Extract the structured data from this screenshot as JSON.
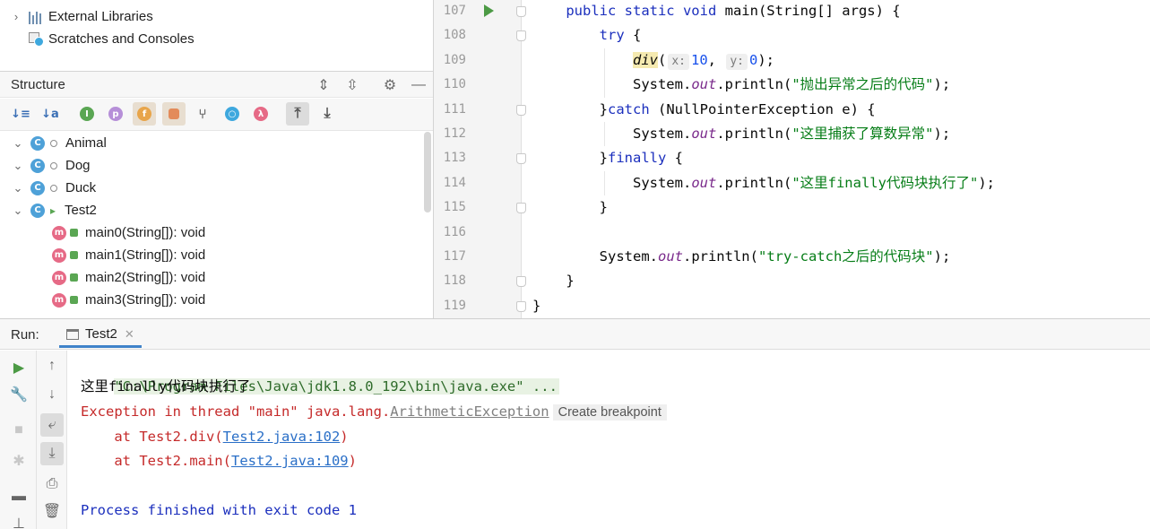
{
  "project_tree": {
    "items": [
      {
        "label": "External Libraries",
        "icon": "library-icon"
      },
      {
        "label": "Scratches and Consoles",
        "icon": "scratches-icon"
      }
    ]
  },
  "structure": {
    "title": "Structure",
    "classes": [
      {
        "name": "Animal"
      },
      {
        "name": "Dog"
      },
      {
        "name": "Duck"
      },
      {
        "name": "Test2"
      }
    ],
    "methods": [
      "main0(String[]): void",
      "main1(String[]): void",
      "main2(String[]): void",
      "main3(String[]): void"
    ]
  },
  "editor": {
    "line_numbers": [
      "107",
      "108",
      "109",
      "110",
      "111",
      "112",
      "113",
      "114",
      "115",
      "116",
      "117",
      "118",
      "119"
    ],
    "lines": [
      {
        "indent": "    ",
        "parts": [
          {
            "t": "kw",
            "v": "public static void "
          },
          {
            "t": "plain",
            "v": "main(String[] args) {"
          }
        ]
      },
      {
        "indent": "        ",
        "parts": [
          {
            "t": "kw",
            "v": "try "
          },
          {
            "t": "plain",
            "v": "{"
          }
        ]
      },
      {
        "indent": "            ",
        "parts": [
          {
            "t": "div",
            "v": "div"
          },
          {
            "t": "plain",
            "v": "("
          },
          {
            "t": "hint",
            "v": "x:"
          },
          {
            "t": "num",
            "v": "10"
          },
          {
            "t": "plain",
            "v": ", "
          },
          {
            "t": "hint",
            "v": "y:"
          },
          {
            "t": "num",
            "v": "0"
          },
          {
            "t": "plain",
            "v": ");"
          }
        ]
      },
      {
        "indent": "            ",
        "parts": [
          {
            "t": "plain",
            "v": "System."
          },
          {
            "t": "ital",
            "v": "out"
          },
          {
            "t": "plain",
            "v": ".println("
          },
          {
            "t": "str",
            "v": "\"抛出异常之后的代码\""
          },
          {
            "t": "plain",
            "v": ");"
          }
        ]
      },
      {
        "indent": "        ",
        "parts": [
          {
            "t": "plain",
            "v": "}"
          },
          {
            "t": "kw",
            "v": "catch "
          },
          {
            "t": "plain",
            "v": "(NullPointerException e) {"
          }
        ]
      },
      {
        "indent": "            ",
        "parts": [
          {
            "t": "plain",
            "v": "System."
          },
          {
            "t": "ital",
            "v": "out"
          },
          {
            "t": "plain",
            "v": ".println("
          },
          {
            "t": "str",
            "v": "\"这里捕获了算数异常\""
          },
          {
            "t": "plain",
            "v": ");"
          }
        ]
      },
      {
        "indent": "        ",
        "parts": [
          {
            "t": "plain",
            "v": "}"
          },
          {
            "t": "kw",
            "v": "finally "
          },
          {
            "t": "plain",
            "v": "{"
          }
        ]
      },
      {
        "indent": "            ",
        "parts": [
          {
            "t": "plain",
            "v": "System."
          },
          {
            "t": "ital",
            "v": "out"
          },
          {
            "t": "plain",
            "v": ".println("
          },
          {
            "t": "str",
            "v": "\"这里finally代码块执行了\""
          },
          {
            "t": "plain",
            "v": ");"
          }
        ]
      },
      {
        "indent": "        ",
        "parts": [
          {
            "t": "plain",
            "v": "}"
          }
        ]
      },
      {
        "indent": "",
        "parts": []
      },
      {
        "indent": "        ",
        "parts": [
          {
            "t": "plain",
            "v": "System."
          },
          {
            "t": "ital",
            "v": "out"
          },
          {
            "t": "plain",
            "v": ".println("
          },
          {
            "t": "str",
            "v": "\"try-catch之后的代码块\""
          },
          {
            "t": "plain",
            "v": ");"
          }
        ]
      },
      {
        "indent": "    ",
        "parts": [
          {
            "t": "plain",
            "v": "}"
          }
        ]
      },
      {
        "indent": "",
        "parts": [
          {
            "t": "plain",
            "v": "}"
          }
        ]
      }
    ]
  },
  "run": {
    "label": "Run:",
    "tab_label": "Test2",
    "console": {
      "command": "\"C:\\Program Files\\Java\\jdk1.8.0_192\\bin\\java.exe\" ...",
      "output_line": "这里finally代码块执行了",
      "exception_prefix": "Exception in thread \"main\" java.lang.",
      "exception_class": "ArithmeticException",
      "create_breakpoint": "Create breakpoint",
      "stack": [
        {
          "prefix": "    at Test2.div(",
          "link": "Test2.java:102",
          "suffix": ")"
        },
        {
          "prefix": "    at Test2.main(",
          "link": "Test2.java:109",
          "suffix": ")"
        }
      ],
      "exit_message": "Process finished with exit code 1"
    }
  },
  "colors": {
    "keyword": "#1b2fbd",
    "string": "#067d17",
    "error": "#c52a2a",
    "link": "#2a6fc7",
    "run_green": "#4c9a45"
  }
}
